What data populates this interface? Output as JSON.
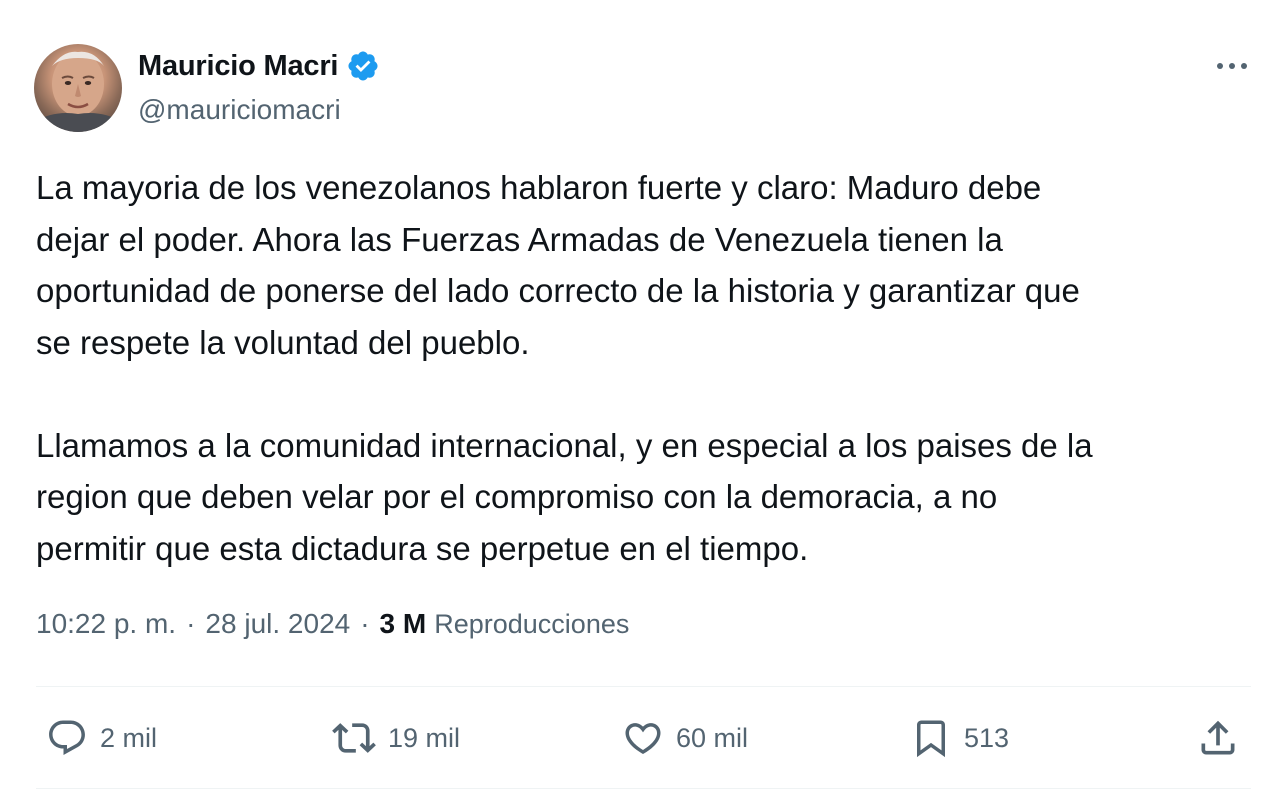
{
  "author": {
    "display_name": "Mauricio Macri",
    "handle": "@mauriciomacri",
    "verified": true,
    "verified_color": "#1d9bf0"
  },
  "tweet": {
    "text": "La mayoria de los venezolanos hablaron fuerte y claro: Maduro debe\ndejar el poder. Ahora las Fuerzas Armadas de Venezuela tienen la\noportunidad de ponerse del lado correcto de la historia y garantizar que\nse respete la voluntad del pueblo.\n\nLlamamos a la comunidad internacional, y en especial a los paises de la\nregion que deben velar por el compromiso con la demoracia, a no\npermitir que esta dictadura se perpetue en el tiempo."
  },
  "meta": {
    "time": "10:22 p. m.",
    "separator": "·",
    "date": "28 jul. 2024",
    "views_count": "3 M",
    "views_label": "Reproducciones"
  },
  "actions": {
    "replies": "2 mil",
    "retweets": "19 mil",
    "likes": "60 mil",
    "bookmarks": "513"
  },
  "icons": {
    "more": "more-icon",
    "reply": "reply-icon",
    "retweet": "retweet-icon",
    "like": "heart-icon",
    "bookmark": "bookmark-icon",
    "share": "share-icon",
    "verified": "verified-badge-icon"
  },
  "colors": {
    "text_primary": "#0f1419",
    "text_secondary": "#536471",
    "divider": "#eff3f4"
  }
}
